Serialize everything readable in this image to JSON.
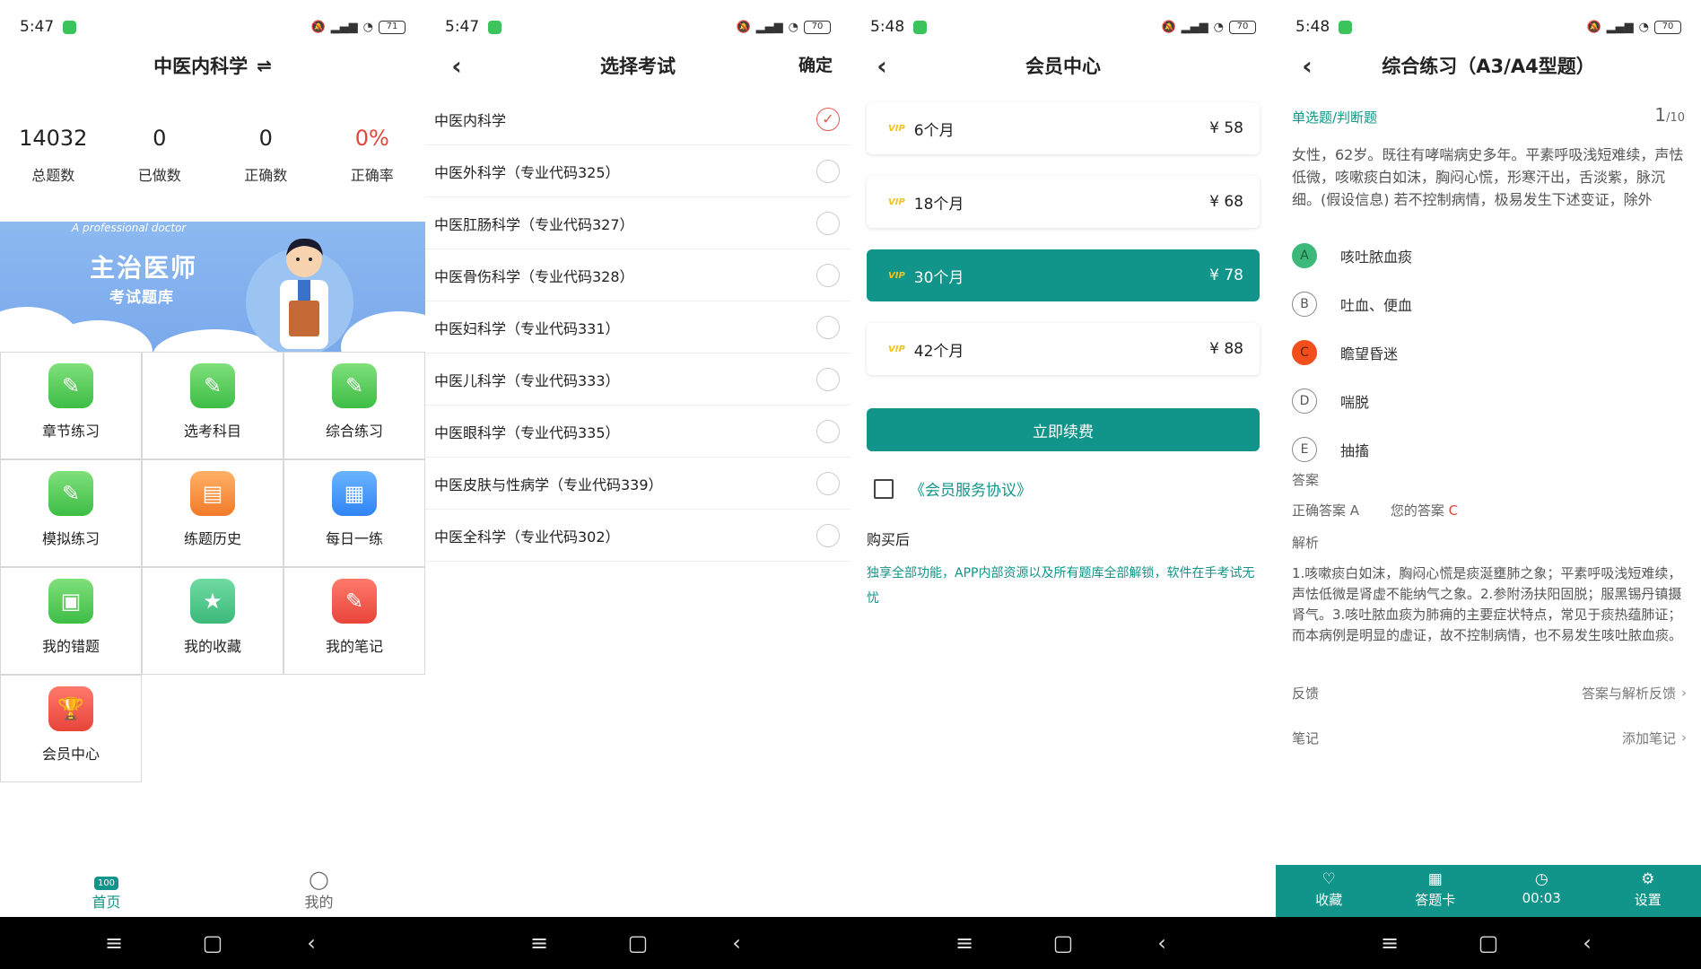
{
  "screen1": {
    "status": {
      "time": "5:47",
      "signal": "5G",
      "battery": "71"
    },
    "title": "中医内科学",
    "switch_icon": "swap-icon",
    "stats": [
      {
        "value": "14032",
        "label": "总题数"
      },
      {
        "value": "0",
        "label": "已做数"
      },
      {
        "value": "0",
        "label": "正确数"
      },
      {
        "value": "0%",
        "label": "正确率"
      }
    ],
    "banner": {
      "subtitle": "A professional doctor",
      "title": "主治医师",
      "subtitle2": "考试题库"
    },
    "grid": [
      {
        "label": "章节练习",
        "icon": "edit-icon",
        "color": "green"
      },
      {
        "label": "选考科目",
        "icon": "edit-icon",
        "color": "green"
      },
      {
        "label": "综合练习",
        "icon": "edit-icon",
        "color": "green"
      },
      {
        "label": "模拟练习",
        "icon": "edit-icon",
        "color": "green"
      },
      {
        "label": "练题历史",
        "icon": "history-icon",
        "color": "orange"
      },
      {
        "label": "每日一练",
        "icon": "document-icon",
        "color": "blue"
      },
      {
        "label": "我的错题",
        "icon": "wrong-book-icon",
        "color": "green"
      },
      {
        "label": "我的收藏",
        "icon": "star-folder-icon",
        "color": "teal"
      },
      {
        "label": "我的笔记",
        "icon": "note-icon",
        "color": "red"
      },
      {
        "label": "会员中心",
        "icon": "trophy-icon",
        "color": "red"
      }
    ],
    "tabs": [
      {
        "label": "首页",
        "icon": "home-100-icon"
      },
      {
        "label": "我的",
        "icon": "user-icon"
      }
    ]
  },
  "screen2": {
    "status": {
      "time": "5:47",
      "battery": "70"
    },
    "title": "选择考试",
    "confirm": "确定",
    "exams": [
      {
        "name": "中医内科学",
        "checked": true
      },
      {
        "name": "中医外科学（专业代码325）",
        "checked": false
      },
      {
        "name": "中医肛肠科学（专业代码327）",
        "checked": false
      },
      {
        "name": "中医骨伤科学（专业代码328）",
        "checked": false
      },
      {
        "name": "中医妇科学（专业代码331）",
        "checked": false
      },
      {
        "name": "中医儿科学（专业代码333）",
        "checked": false
      },
      {
        "name": "中医眼科学（专业代码335）",
        "checked": false
      },
      {
        "name": "中医皮肤与性病学（专业代码339）",
        "checked": false
      },
      {
        "name": "中医全科学（专业代码302）",
        "checked": false
      }
    ]
  },
  "screen3": {
    "status": {
      "time": "5:48",
      "battery": "70"
    },
    "title": "会员中心",
    "plans": [
      {
        "badge": "VIP",
        "duration": "6个月",
        "price": "¥ 58",
        "selected": false
      },
      {
        "badge": "VIP",
        "duration": "18个月",
        "price": "¥ 68",
        "selected": false
      },
      {
        "badge": "VIP",
        "duration": "30个月",
        "price": "¥ 78",
        "selected": true
      },
      {
        "badge": "VIP",
        "duration": "42个月",
        "price": "¥ 88",
        "selected": false
      }
    ],
    "renew": "立即续费",
    "agreement": "《会员服务协议》",
    "after_title": "购买后",
    "after_desc": "独享全部功能，APP内部资源以及所有题库全部解锁，软件在手考试无忧"
  },
  "screen4": {
    "status": {
      "time": "5:48",
      "battery": "70"
    },
    "title": "综合练习（A3/A4型题）",
    "qtype": "单选题/判断题",
    "qnum": "1",
    "qtotal": "/10",
    "question": "女性，62岁。既往有哮喘病史多年。平素呼吸浅短难续，声怯低微，咳嗽痰白如沫，胸闷心慌，形寒汗出，舌淡紫，脉沉细。(假设信息) 若不控制病情，极易发生下述变证，除外",
    "options": [
      {
        "letter": "A",
        "text": "咳吐脓血痰",
        "state": "correct"
      },
      {
        "letter": "B",
        "text": "吐血、便血",
        "state": "none"
      },
      {
        "letter": "C",
        "text": "瞻望昏迷",
        "state": "wrong"
      },
      {
        "letter": "D",
        "text": "喘脱",
        "state": "none"
      },
      {
        "letter": "E",
        "text": "抽搐",
        "state": "none"
      }
    ],
    "answer_heading": "答案",
    "correct_label": "正确答案 A",
    "your_label": "您的答案",
    "your_value": "C",
    "analysis_heading": "解析",
    "analysis": "1.咳嗽痰白如沫，胸闷心慌是痰涎壅肺之象；平素呼吸浅短难续，声怯低微是肾虚不能纳气之象。2.参附汤扶阳固脱；服黑锡丹镇摄肾气。3.咳吐脓血痰为肺痈的主要症状特点，常见于痰热蕴肺证；而本病例是明显的虚证，故不控制病情，也不易发生咳吐脓血痰。",
    "feedback_label": "反馈",
    "feedback_value": "答案与解析反馈",
    "note_label": "笔记",
    "note_value": "添加笔记",
    "bottom": [
      {
        "label": "收藏",
        "icon": "heart-icon"
      },
      {
        "label": "答题卡",
        "icon": "grid-card-icon"
      },
      {
        "label": "00:03",
        "icon": "clock-icon"
      },
      {
        "label": "设置",
        "icon": "gear-icon"
      }
    ]
  },
  "colors": {
    "accent": "#11958a",
    "red": "#e0453c",
    "vip": "#f2c21d"
  }
}
